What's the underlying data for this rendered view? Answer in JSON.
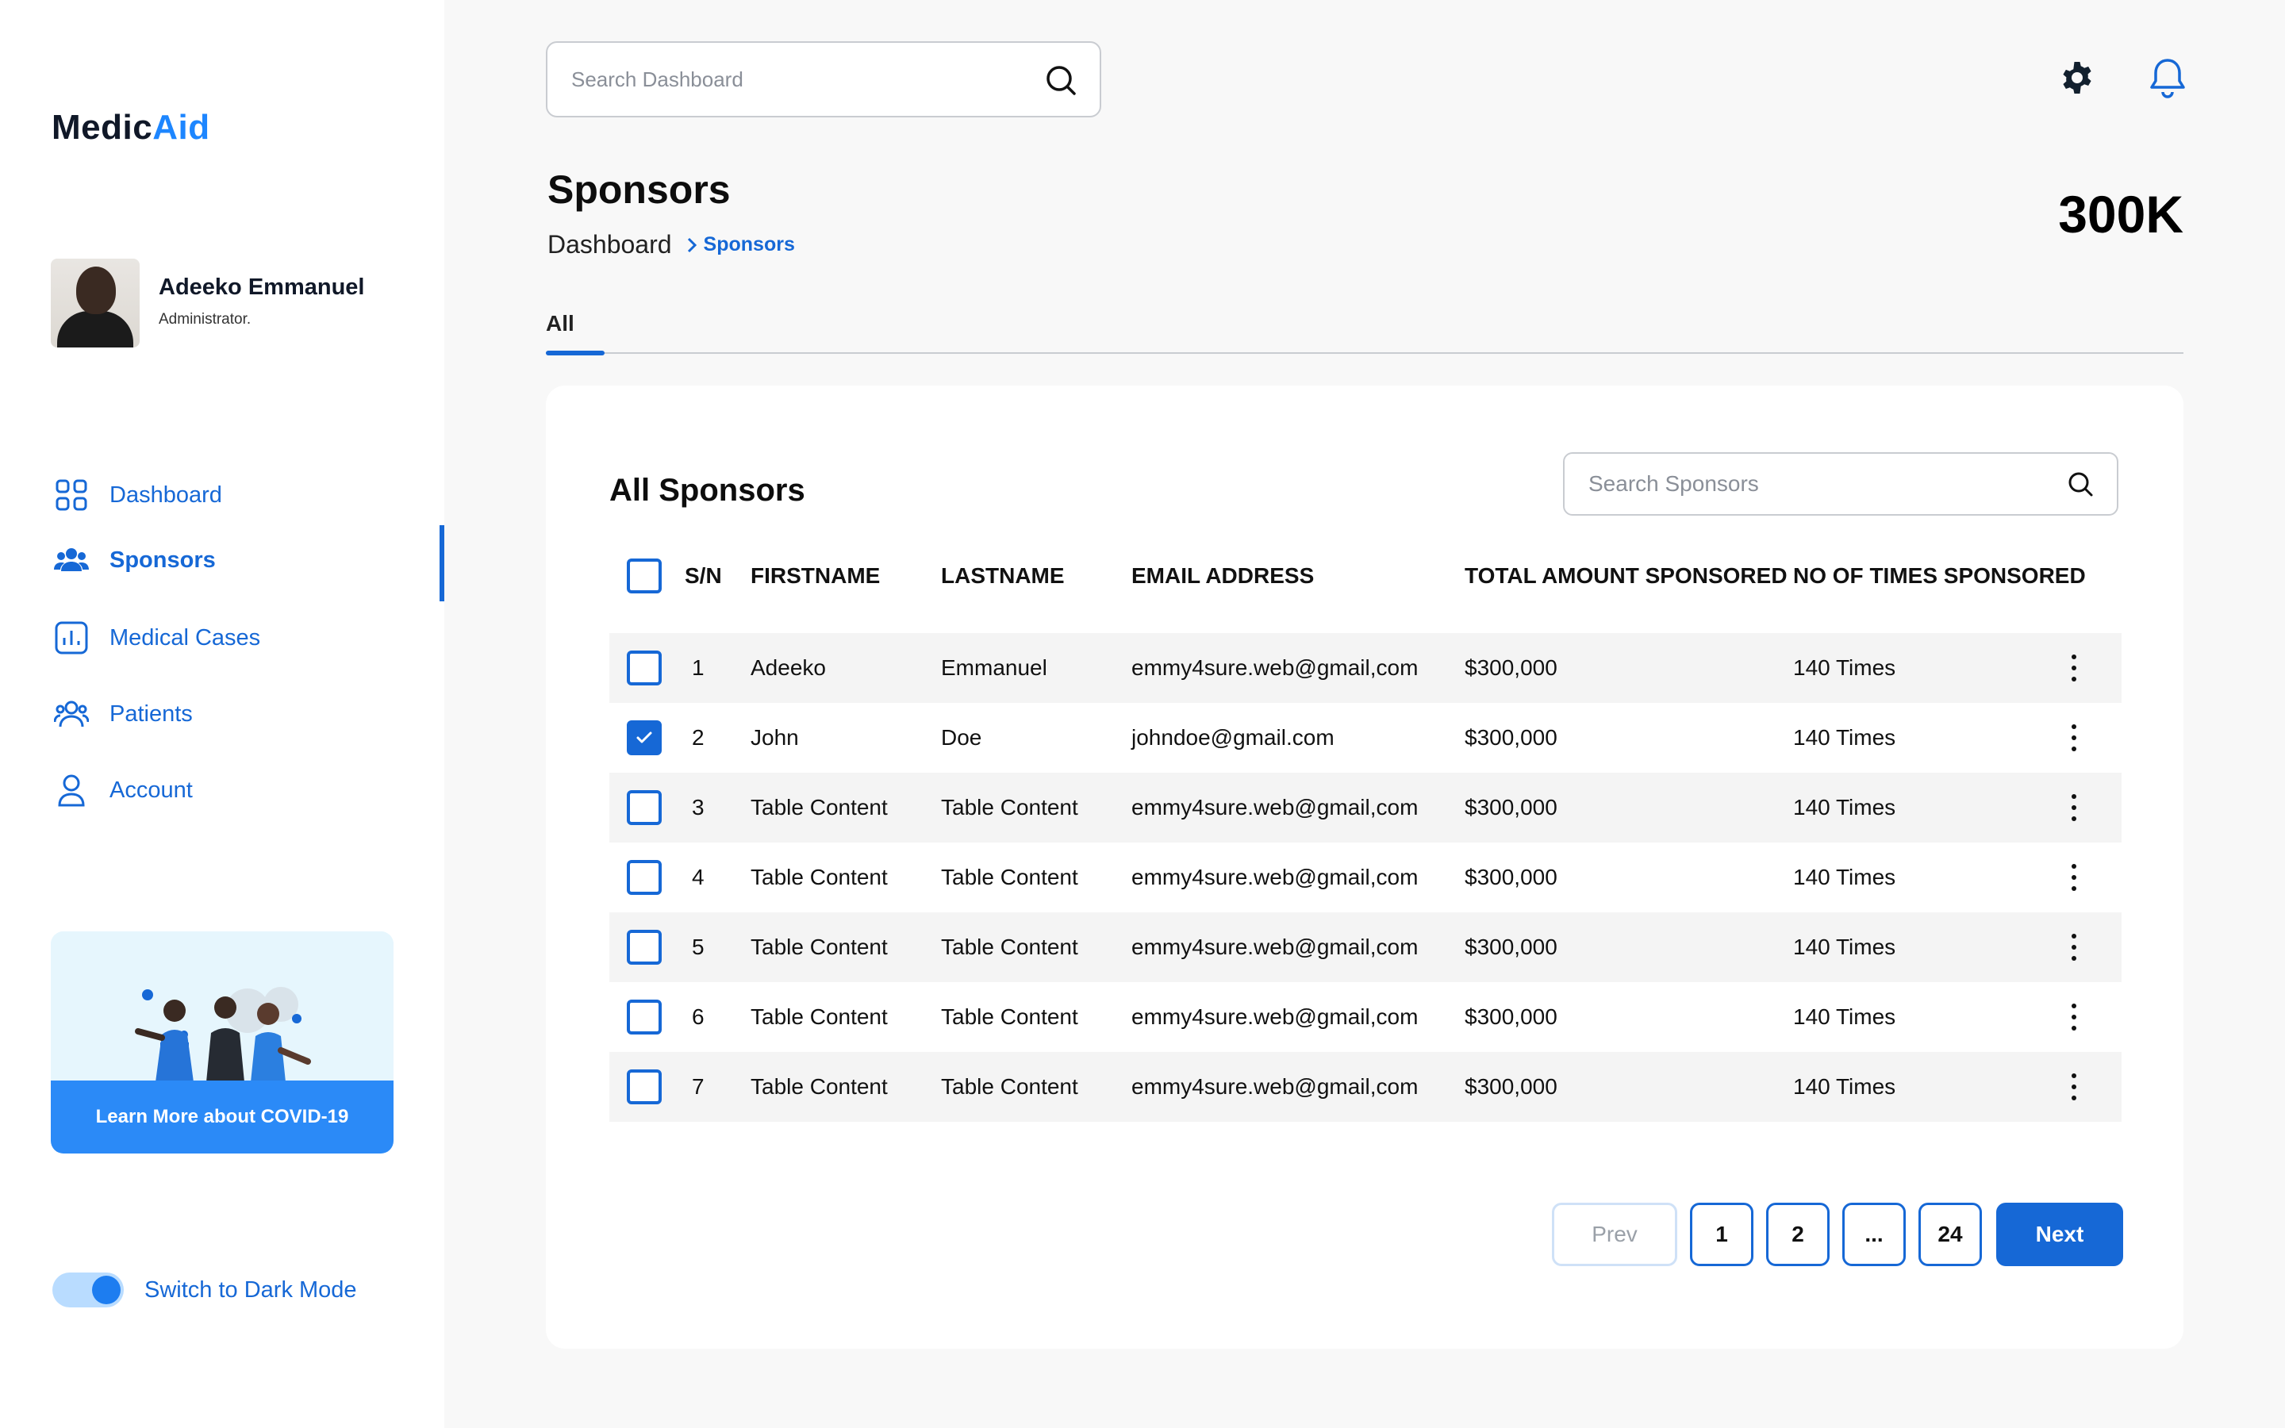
{
  "brand": {
    "part1": "Medic",
    "part2": "Aid"
  },
  "profile": {
    "name": "Adeeko Emmanuel",
    "role": "Administrator."
  },
  "nav": [
    {
      "label": "Dashboard",
      "icon": "grid-icon"
    },
    {
      "label": "Sponsors",
      "icon": "users-icon",
      "active": true
    },
    {
      "label": "Medical Cases",
      "icon": "chart-icon"
    },
    {
      "label": "Patients",
      "icon": "patients-icon"
    },
    {
      "label": "Account",
      "icon": "user-icon"
    }
  ],
  "covid": {
    "button": "Learn More about COVID-19"
  },
  "dark_mode": {
    "label": "Switch to Dark Mode",
    "enabled": true
  },
  "header": {
    "search_placeholder": "Search Dashboard"
  },
  "page": {
    "title": "Sponsors",
    "breadcrumb_root": "Dashboard",
    "breadcrumb_current": "Sponsors",
    "total": "300K"
  },
  "tabs": [
    {
      "label": "All",
      "active": true
    }
  ],
  "table": {
    "title": "All Sponsors",
    "search_placeholder": "Search Sponsors",
    "headers": {
      "sn": "S/N",
      "firstname": "FIRSTNAME",
      "lastname": "LASTNAME",
      "email": "EMAIL ADDRESS",
      "total": "TOTAL AMOUNT SPONSORED",
      "times": "NO OF TIMES SPONSORED"
    },
    "rows": [
      {
        "sn": "1",
        "firstname": "Adeeko",
        "lastname": "Emmanuel",
        "email": "emmy4sure.web@gmail,com",
        "total": "$300,000",
        "times": "140 Times",
        "checked": false
      },
      {
        "sn": "2",
        "firstname": "John",
        "lastname": "Doe",
        "email": "johndoe@gmail.com",
        "total": "$300,000",
        "times": "140 Times",
        "checked": true
      },
      {
        "sn": "3",
        "firstname": "Table Content",
        "lastname": "Table Content",
        "email": "emmy4sure.web@gmail,com",
        "total": "$300,000",
        "times": "140 Times",
        "checked": false
      },
      {
        "sn": "4",
        "firstname": "Table Content",
        "lastname": "Table Content",
        "email": "emmy4sure.web@gmail,com",
        "total": "$300,000",
        "times": "140 Times",
        "checked": false
      },
      {
        "sn": "5",
        "firstname": "Table Content",
        "lastname": "Table Content",
        "email": "emmy4sure.web@gmail,com",
        "total": "$300,000",
        "times": "140 Times",
        "checked": false
      },
      {
        "sn": "6",
        "firstname": "Table Content",
        "lastname": "Table Content",
        "email": "emmy4sure.web@gmail,com",
        "total": "$300,000",
        "times": "140 Times",
        "checked": false
      },
      {
        "sn": "7",
        "firstname": "Table Content",
        "lastname": "Table Content",
        "email": "emmy4sure.web@gmail,com",
        "total": "$300,000",
        "times": "140 Times",
        "checked": false
      }
    ]
  },
  "pagination": {
    "prev": "Prev",
    "pages": [
      "1",
      "2",
      "...",
      "24"
    ],
    "next": "Next"
  },
  "colors": {
    "primary": "#1668d6",
    "accent": "#1d86ff",
    "card_bg": "#ffffff",
    "page_bg": "#f8f8f8"
  }
}
